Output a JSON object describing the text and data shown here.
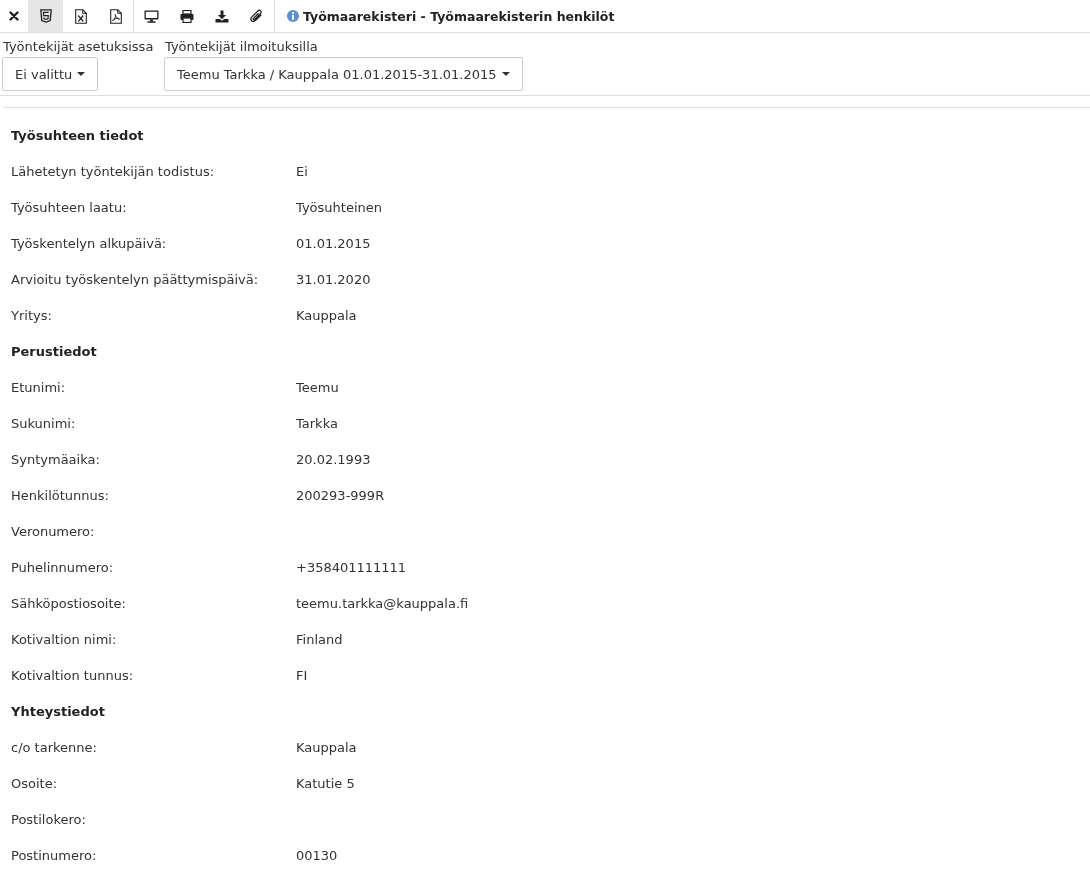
{
  "toolbar": {
    "tool_groups": [
      {
        "tools": [
          {
            "kind": "close",
            "selected": false
          },
          {
            "kind": "html",
            "selected": true
          },
          {
            "kind": "excel",
            "selected": false
          },
          {
            "kind": "pdf",
            "selected": false
          }
        ]
      },
      {
        "tools": [
          {
            "kind": "monitor",
            "selected": false
          },
          {
            "kind": "print",
            "selected": false
          },
          {
            "kind": "download",
            "selected": false
          },
          {
            "kind": "attachment",
            "selected": false
          }
        ]
      }
    ],
    "title": "Työmaarekisteri - Työmaarekisterin henkilöt"
  },
  "filters": [
    {
      "label": "Työntekijät asetuksissa",
      "value": "Ei valittu"
    },
    {
      "label": "Työntekijät ilmoituksilla",
      "value": "Teemu Tarkka / Kauppala 01.01.2015-31.01.2015"
    }
  ],
  "sections": [
    {
      "heading": "Työsuhteen tiedot",
      "fields": [
        {
          "label": "Lähetetyn työntekijän todistus:",
          "value": "Ei"
        },
        {
          "label": "Työsuhteen laatu:",
          "value": "Työsuhteinen"
        },
        {
          "label": "Työskentelyn alkupäivä:",
          "value": "01.01.2015"
        },
        {
          "label": "Arvioitu työskentelyn päättymispäivä:",
          "value": "31.01.2020"
        },
        {
          "label": "Yritys:",
          "value": "Kauppala"
        }
      ]
    },
    {
      "heading": "Perustiedot",
      "fields": [
        {
          "label": "Etunimi:",
          "value": "Teemu"
        },
        {
          "label": "Sukunimi:",
          "value": "Tarkka"
        },
        {
          "label": "Syntymäaika:",
          "value": "20.02.1993"
        },
        {
          "label": "Henkilötunnus:",
          "value": "200293-999R"
        },
        {
          "label": "Veronumero:"
        },
        {
          "label": "Puhelinnumero:",
          "value": "+358401111111"
        },
        {
          "label": "Sähköpostiosoite:",
          "value": "teemu.tarkka@kauppala.fi"
        },
        {
          "label": "Kotivaltion nimi:",
          "value": "Finland"
        },
        {
          "label": "Kotivaltion tunnus:",
          "value": "FI"
        }
      ]
    },
    {
      "heading": "Yhteystiedot",
      "fields": [
        {
          "label": "c/o tarkenne:",
          "value": "Kauppala"
        },
        {
          "label": "Osoite:",
          "value": "Katutie 5"
        },
        {
          "label": "Postilokero:"
        },
        {
          "label": "Postinumero:",
          "value": "00130"
        }
      ]
    }
  ]
}
